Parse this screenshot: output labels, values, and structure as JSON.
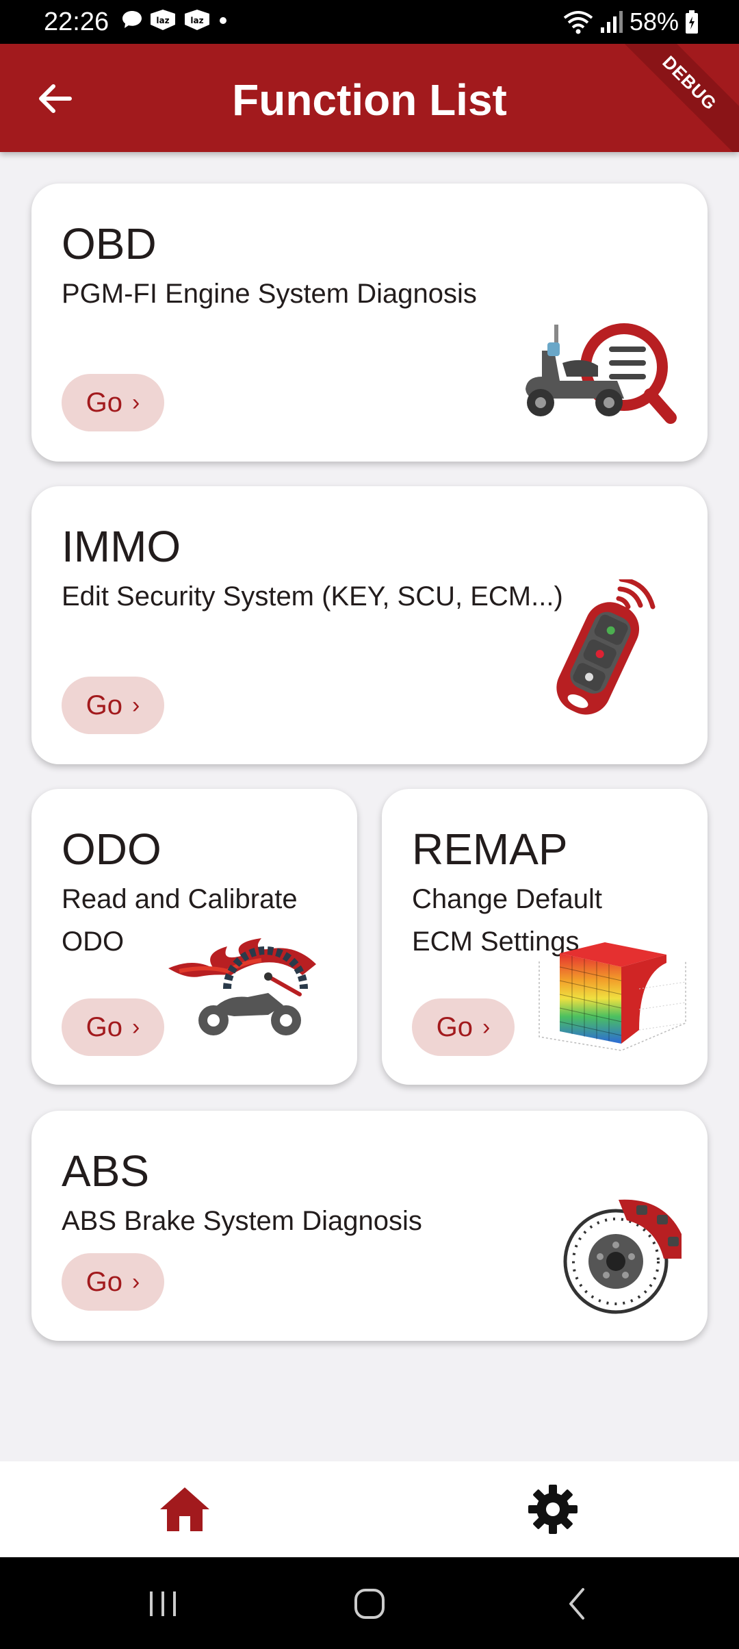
{
  "status_bar": {
    "time": "22:26",
    "battery": "58%",
    "notifications": [
      "chat-bubble-icon",
      "laz-icon",
      "laz-icon",
      "dot-icon"
    ]
  },
  "app_bar": {
    "title": "Function List",
    "debug_label": "DEBUG"
  },
  "cards": {
    "obd": {
      "title": "OBD",
      "subtitle": "PGM-FI Engine System Diagnosis",
      "go_label": "Go",
      "illustration": "scooter-search-icon"
    },
    "immo": {
      "title": "IMMO",
      "subtitle": "Edit Security System (KEY, SCU, ECM...)",
      "go_label": "Go",
      "illustration": "key-fob-icon"
    },
    "odo": {
      "title": "ODO",
      "subtitle_line1": "Read and Calibrate",
      "subtitle_line2": "ODO",
      "go_label": "Go",
      "illustration": "motorbike-speedometer-icon"
    },
    "remap": {
      "title": "REMAP",
      "subtitle_line1": "Change Default",
      "subtitle_line2": "ECM Settings",
      "go_label": "Go",
      "illustration": "3d-map-chart-icon"
    },
    "abs": {
      "title": "ABS",
      "subtitle": "ABS Brake System Diagnosis",
      "go_label": "Go",
      "illustration": "brake-disc-icon"
    }
  },
  "bottom_nav": {
    "items": [
      {
        "icon": "home-icon",
        "active": true
      },
      {
        "icon": "gear-icon",
        "active": false
      }
    ]
  },
  "colors": {
    "primary": "#a21a1d",
    "go_button_bg": "#efd5d3",
    "background": "#f2f1f4"
  }
}
